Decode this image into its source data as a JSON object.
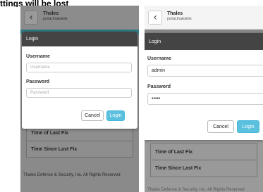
{
  "caption": "ttings will be lost",
  "left_screen": {
    "header": {
      "back_glyph": "‹",
      "title": "Thales",
      "subtitle": "portal.thaleslink"
    },
    "dialog": {
      "title": "Login",
      "username_label": "Username",
      "username_placeholder": "Username",
      "username_value": "",
      "password_label": "Password",
      "password_placeholder": "Password",
      "password_value": "",
      "cancel_label": "Cancel",
      "login_label": "Login"
    },
    "info": {
      "row1": "Time of Last Fix",
      "row2": "Time Since Last Fix"
    },
    "footer": "Thales Defense & Security, Inc. All Rights Reserved"
  },
  "right_screen": {
    "header": {
      "back_glyph": "‹",
      "title": "Thales",
      "subtitle": "portal.thaleslink"
    },
    "dialog": {
      "title": "Login",
      "username_label": "Username",
      "username_value": "admin",
      "password_label": "Password",
      "password_value": "•••••",
      "cancel_label": "Cancel",
      "login_label": "Login"
    },
    "info": {
      "row1": "Time of Last Fix",
      "row2": "Time Since Last Fix"
    },
    "footer": "Thales Defense & Security, Inc. All Rights Reserved"
  },
  "colors": {
    "accent": "#5bc0de",
    "dialog_header": "#444444",
    "teal_bar": "#2f7d82",
    "overlay_gray": "#8a8a8a"
  },
  "icons": {
    "back": "chevron-left-icon"
  }
}
